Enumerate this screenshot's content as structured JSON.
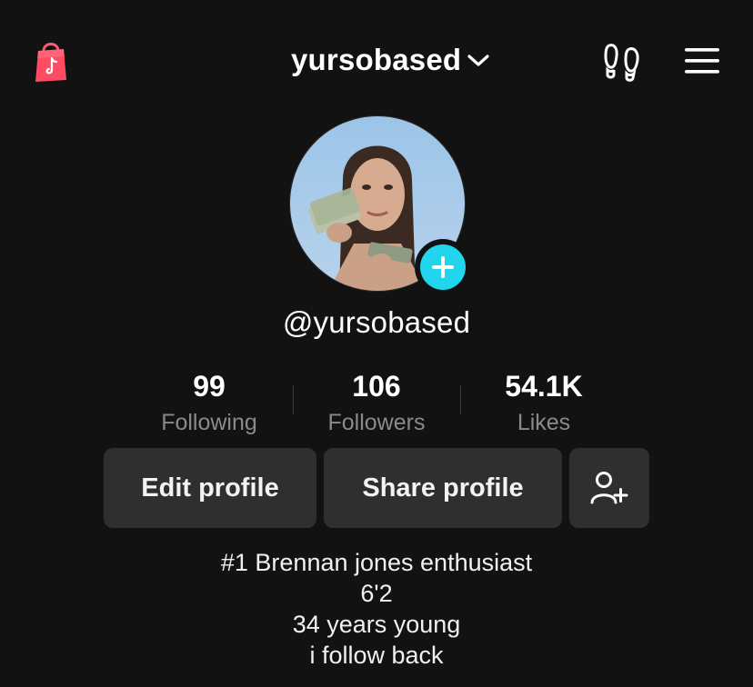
{
  "header": {
    "username": "yursobased",
    "icons": {
      "shop": "shopping-bag-icon",
      "switch": "chevron-down-icon",
      "footprints": "footprints-icon",
      "menu": "hamburger-menu-icon"
    }
  },
  "profile": {
    "avatar": "profile-photo",
    "add_icon": "plus-icon",
    "handle": "@yursobased"
  },
  "stats": [
    {
      "value": "99",
      "label": "Following"
    },
    {
      "value": "106",
      "label": "Followers"
    },
    {
      "value": "54.1K",
      "label": "Likes"
    }
  ],
  "actions": {
    "edit_label": "Edit profile",
    "share_label": "Share profile",
    "add_friend_icon": "add-user-icon"
  },
  "bio": {
    "lines": [
      "#1 Brennan jones enthusiast",
      "6'2",
      "34 years young",
      "i follow back"
    ]
  },
  "colors": {
    "background": "#121212",
    "button": "#2f2f2f",
    "accent": "#20d5ec",
    "shop": "#fe2c55",
    "secondary_text": "#8a8a8a"
  }
}
